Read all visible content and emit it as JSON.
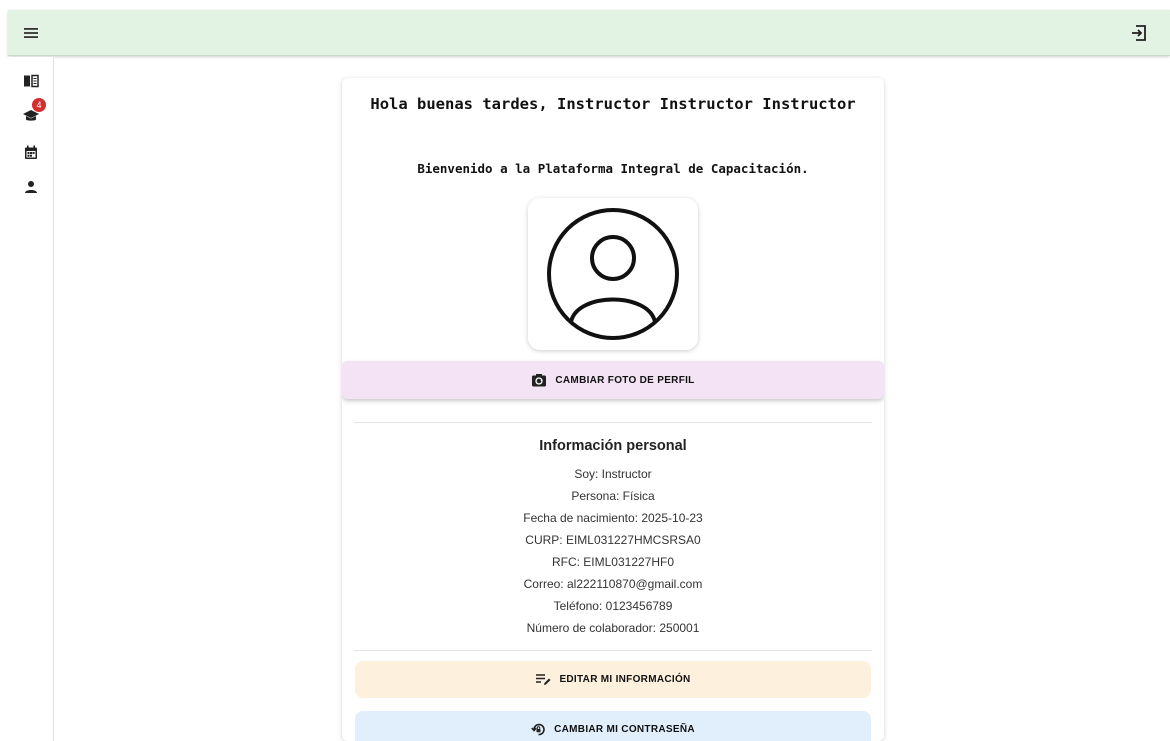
{
  "topbar": {
    "menu_icon": "hamburger-menu-icon",
    "logout_icon": "logout-icon"
  },
  "sidebar": {
    "items": [
      {
        "icon": "book-icon"
      },
      {
        "icon": "graduation-cap-icon",
        "badge": "4"
      },
      {
        "icon": "calendar-icon"
      },
      {
        "icon": "person-icon"
      }
    ]
  },
  "profile": {
    "greeting": "Hola buenas tardes, Instructor Instructor Instructor",
    "welcome": "Bienvenido a la Plataforma Integral de Capacitación.",
    "avatar_icon": "user-circle-icon",
    "change_photo_label": "CAMBIAR FOTO DE PERFIL",
    "change_photo_icon": "camera-switch-icon"
  },
  "personal_info": {
    "title": "Información personal",
    "lines": [
      "Soy: Instructor",
      "Persona: Física",
      "Fecha de nacimiento: 2025-10-23",
      "CURP: EIML031227HMCSRSA0",
      "RFC: EIML031227HF0",
      "Correo: al222110870@gmail.com",
      "Teléfono: 0123456789",
      "Número de colaborador: 250001"
    ]
  },
  "actions": {
    "edit_label": "EDITAR MI INFORMACIÓN",
    "edit_icon": "edit-notes-icon",
    "password_label": "CAMBIAR MI CONTRASEÑA",
    "password_icon": "lock-reset-icon"
  },
  "colors": {
    "topbar_bg": "#e3f3e3",
    "photo_btn_bg": "#f3e3f5",
    "edit_btn_bg": "#fdf0dc",
    "password_btn_bg": "#e1eefb",
    "badge": "#d32f2f"
  }
}
